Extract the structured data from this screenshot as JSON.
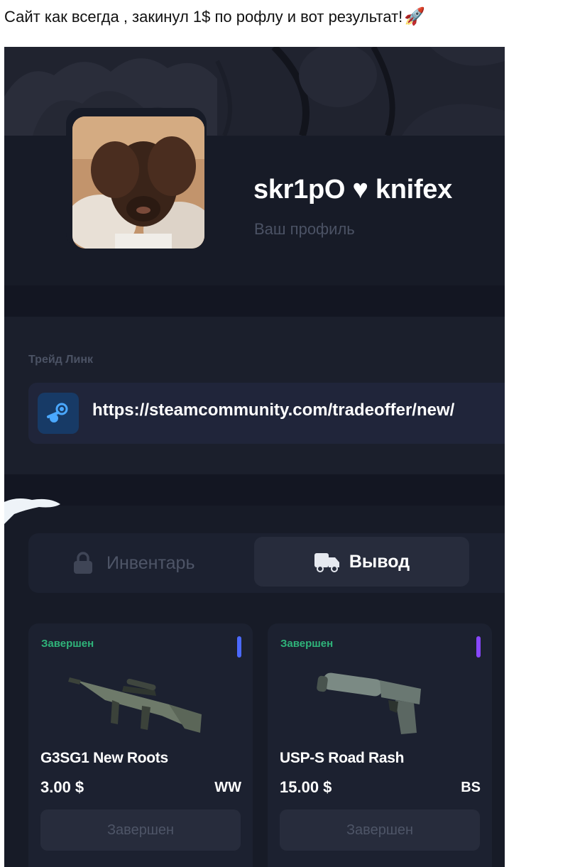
{
  "caption": {
    "text": "Сайт как всегда , закинул 1$ по рофлу и вот результат!",
    "emoji": "🚀"
  },
  "profile": {
    "username": "skr1pO ♥ knifex",
    "subtitle": "Ваш профиль"
  },
  "trade": {
    "label": "Трейд Линк",
    "link": "https://steamcommunity.com/tradeoffer/new/"
  },
  "tabs": [
    {
      "label": "Инвентарь",
      "icon": "lock-icon",
      "active": false
    },
    {
      "label": "Вывод",
      "icon": "truck-icon",
      "active": true
    }
  ],
  "items": [
    {
      "status": "Завершен",
      "name": "G3SG1 New Roots",
      "price": "3.00 $",
      "wear": "WW",
      "button": "Завершен",
      "rarity_color": "#4b69ff",
      "icon": "rifle-icon"
    },
    {
      "status": "Завершен",
      "name": "USP-S Road Rash",
      "price": "15.00 $",
      "wear": "BS",
      "button": "Завершен",
      "rarity_color": "#8847ff",
      "icon": "pistol-icon"
    }
  ],
  "colors": {
    "background": "#171b27",
    "status_green": "#2fb47a",
    "steam_blue": "#173a66"
  }
}
